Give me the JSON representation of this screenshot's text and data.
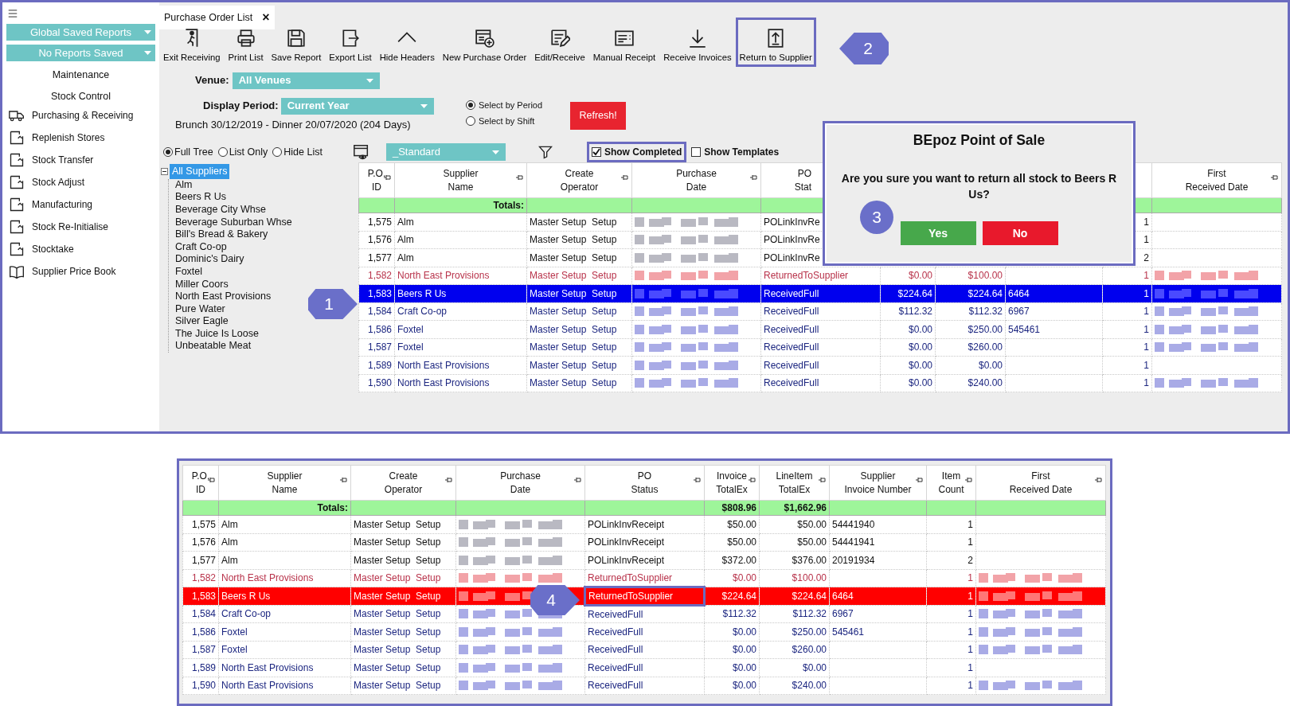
{
  "sidebar": {
    "reports": [
      {
        "label": "Global Saved Reports"
      },
      {
        "label": "No Reports Saved"
      }
    ],
    "sections": [
      {
        "label": "Maintenance"
      },
      {
        "label": "Stock Control"
      }
    ],
    "items": [
      {
        "label": "Purchasing & Receiving",
        "kind": "truck"
      },
      {
        "label": "Replenish Stores",
        "kind": "doc"
      },
      {
        "label": "Stock Transfer",
        "kind": "doc"
      },
      {
        "label": "Stock Adjust",
        "kind": "doc"
      },
      {
        "label": "Manufacturing",
        "kind": "doc"
      },
      {
        "label": "Stock Re-Initialise",
        "kind": "doc"
      },
      {
        "label": "Stocktake",
        "kind": "doc"
      },
      {
        "label": "Supplier Price Book",
        "kind": "book"
      }
    ]
  },
  "tab": {
    "label": "Purchase Order List",
    "close": "×"
  },
  "toolbar": [
    {
      "label": "Exit Receiving",
      "kind": "exit",
      "highlighted": false
    },
    {
      "label": "Print List",
      "kind": "print",
      "highlighted": false
    },
    {
      "label": "Save Report",
      "kind": "save",
      "highlighted": false
    },
    {
      "label": "Export List",
      "kind": "export",
      "highlighted": false
    },
    {
      "label": "Hide Headers",
      "kind": "hide",
      "highlighted": false
    },
    {
      "label": "New Purchase Order",
      "kind": "new",
      "highlighted": false
    },
    {
      "label": "Edit/Receive",
      "kind": "edit",
      "highlighted": false
    },
    {
      "label": "Manual Receipt",
      "kind": "receipt",
      "highlighted": false
    },
    {
      "label": "Receive Invoices",
      "kind": "download",
      "highlighted": false
    },
    {
      "label": "Return to Supplier",
      "kind": "upload",
      "highlighted": true
    }
  ],
  "venue": {
    "label": "Venue:",
    "value": "All Venues"
  },
  "period": {
    "label": "Display Period:",
    "value": "Current Year",
    "range": "Brunch 30/12/2019 - Dinner 20/07/2020 (204 Days)"
  },
  "period_modes": [
    {
      "label": "Select by Period",
      "selected": true
    },
    {
      "label": "Select by Shift",
      "selected": false
    }
  ],
  "refresh": "Refresh!",
  "list_modes": [
    {
      "label": "Full Tree",
      "selected": true
    },
    {
      "label": "List Only",
      "selected": false
    },
    {
      "label": "Hide List",
      "selected": false
    }
  ],
  "layout_select": {
    "value": "_Standard"
  },
  "toggles": [
    {
      "label": "Show Completed",
      "checked": true,
      "highlighted": true
    },
    {
      "label": "Show Templates",
      "checked": false,
      "highlighted": false
    }
  ],
  "tree": {
    "label": "All Suppliers",
    "selected": true,
    "expanded": true,
    "children": [
      {
        "label": "Alm",
        "selected": false
      },
      {
        "label": "Beers R Us",
        "selected": false
      },
      {
        "label": "Beverage City Whse",
        "selected": false
      },
      {
        "label": "Beverage Suburban Whse",
        "selected": false
      },
      {
        "label": "Bill's Bread & Bakery",
        "selected": false
      },
      {
        "label": "Craft Co-op",
        "selected": false
      },
      {
        "label": "Dominic's Dairy",
        "selected": false
      },
      {
        "label": "Foxtel",
        "selected": false
      },
      {
        "label": "Miller Coors",
        "selected": false
      },
      {
        "label": "North East Provisions",
        "selected": false
      },
      {
        "label": "Pure Water",
        "selected": false
      },
      {
        "label": "Silver Eagle",
        "selected": false
      },
      {
        "label": "The Juice Is Loose",
        "selected": false
      },
      {
        "label": "Unbeatable Meat",
        "selected": false
      }
    ]
  },
  "orders_table": {
    "columns": [
      {
        "label": "P.O. ID"
      },
      {
        "label": "Supplier Name"
      },
      {
        "label": "Create Operator"
      },
      {
        "label": "Purchase Date"
      },
      {
        "label": "PO Stat"
      },
      null,
      null,
      null,
      null,
      {
        "label": "First Received Date"
      }
    ],
    "totals_label": "Totals:",
    "rows": [
      {
        "id": "1,575",
        "supplier": "Alm",
        "operator": "Master Setup  Setup",
        "status": "POLinkInvRe",
        "count": "1",
        "kind": "linked",
        "selected": false,
        "received_redacted": false
      },
      {
        "id": "1,576",
        "supplier": "Alm",
        "operator": "Master Setup  Setup",
        "status": "POLinkInvRe",
        "count": "1",
        "kind": "linked",
        "selected": false,
        "received_redacted": false
      },
      {
        "id": "1,577",
        "supplier": "Alm",
        "operator": "Master Setup  Setup",
        "status": "POLinkInvRe",
        "count": "2",
        "kind": "linked",
        "selected": false,
        "received_redacted": false
      },
      {
        "id": "1,582",
        "supplier": "North East Provisions",
        "operator": "Master Setup  Setup",
        "status": "ReturnedToSupplier",
        "invoice": "$0.00",
        "lineitem": "$100.00",
        "count": "1",
        "kind": "returned",
        "selected": false,
        "received_redacted": true
      },
      {
        "id": "1,583",
        "supplier": "Beers R Us",
        "operator": "Master Setup  Setup",
        "status": "ReceivedFull",
        "invoice": "$224.64",
        "lineitem": "$224.64",
        "invoice_no": "6464",
        "count": "1",
        "kind": "received",
        "selected": true,
        "received_redacted": true
      },
      {
        "id": "1,584",
        "supplier": "Craft Co-op",
        "operator": "Master Setup  Setup",
        "status": "ReceivedFull",
        "invoice": "$112.32",
        "lineitem": "$112.32",
        "invoice_no": "6967",
        "count": "1",
        "kind": "received",
        "selected": false,
        "received_redacted": true
      },
      {
        "id": "1,586",
        "supplier": "Foxtel",
        "operator": "Master Setup  Setup",
        "status": "ReceivedFull",
        "invoice": "$0.00",
        "lineitem": "$250.00",
        "invoice_no": "545461",
        "count": "1",
        "kind": "received",
        "selected": false,
        "received_redacted": true
      },
      {
        "id": "1,587",
        "supplier": "Foxtel",
        "operator": "Master Setup  Setup",
        "status": "ReceivedFull",
        "invoice": "$0.00",
        "lineitem": "$260.00",
        "count": "1",
        "kind": "received",
        "selected": false,
        "received_redacted": true
      },
      {
        "id": "1,589",
        "supplier": "North East Provisions",
        "operator": "Master Setup  Setup",
        "status": "ReceivedFull",
        "invoice": "$0.00",
        "lineitem": "$0.00",
        "count": "1",
        "kind": "received",
        "selected": false,
        "received_redacted": false
      },
      {
        "id": "1,590",
        "supplier": "North East Provisions",
        "operator": "Master Setup  Setup",
        "status": "ReceivedFull",
        "invoice": "$0.00",
        "lineitem": "$240.00",
        "count": "1",
        "kind": "received",
        "selected": false,
        "received_redacted": true
      }
    ]
  },
  "dialog": {
    "title": "BEpoz Point of Sale",
    "message": "Are you sure you want to return all stock to Beers R Us?",
    "buttons": [
      {
        "label": "Yes",
        "kind": "confirm"
      },
      {
        "label": "No",
        "kind": "cancel"
      }
    ]
  },
  "callouts": [
    {
      "label": "1"
    },
    {
      "label": "2"
    },
    {
      "label": "3"
    },
    {
      "label": "4"
    }
  ],
  "result_table": {
    "columns": [
      {
        "label": "P.O. ID"
      },
      {
        "label": "Supplier Name"
      },
      {
        "label": "Create Operator"
      },
      {
        "label": "Purchase Date"
      },
      {
        "label": "PO Status"
      },
      {
        "label": "Invoice TotalEx"
      },
      {
        "label": "LineItem TotalEx"
      },
      {
        "label": "Supplier Invoice Number"
      },
      {
        "label": "Item Count"
      },
      {
        "label": "First Received Date"
      }
    ],
    "totals_label": "Totals:",
    "totals": {
      "invoice": "$808.96",
      "lineitem": "$1,662.96"
    },
    "rows": [
      {
        "id": "1,575",
        "supplier": "Alm",
        "operator": "Master Setup  Setup",
        "status": "POLinkInvReceipt",
        "invoice": "$50.00",
        "lineitem": "$50.00",
        "invoice_no": "54441940",
        "count": "1",
        "kind": "linked",
        "selected": false,
        "received_redacted": false,
        "highlighted": false
      },
      {
        "id": "1,576",
        "supplier": "Alm",
        "operator": "Master Setup  Setup",
        "status": "POLinkInvReceipt",
        "invoice": "$50.00",
        "lineitem": "$50.00",
        "invoice_no": "54441941",
        "count": "1",
        "kind": "linked",
        "selected": false,
        "received_redacted": false,
        "highlighted": false
      },
      {
        "id": "1,577",
        "supplier": "Alm",
        "operator": "Master Setup  Setup",
        "status": "POLinkInvReceipt",
        "invoice": "$372.00",
        "lineitem": "$376.00",
        "invoice_no": "20191934",
        "count": "2",
        "kind": "linked",
        "selected": false,
        "received_redacted": false,
        "highlighted": false
      },
      {
        "id": "1,582",
        "supplier": "North East Provisions",
        "operator": "Master Setup  Setup",
        "status": "ReturnedToSupplier",
        "invoice": "$0.00",
        "lineitem": "$100.00",
        "count": "1",
        "kind": "returned",
        "selected": false,
        "received_redacted": true,
        "highlighted": false
      },
      {
        "id": "1,583",
        "supplier": "Beers R Us",
        "operator": "Master Setup  Setup",
        "status": "ReturnedToSupplier",
        "invoice": "$224.64",
        "lineitem": "$224.64",
        "invoice_no": "6464",
        "count": "1",
        "kind": "returned",
        "selected": true,
        "received_redacted": true,
        "highlighted": true
      },
      {
        "id": "1,584",
        "supplier": "Craft Co-op",
        "operator": "Master Setup  Setup",
        "status": "ReceivedFull",
        "invoice": "$112.32",
        "lineitem": "$112.32",
        "invoice_no": "6967",
        "count": "1",
        "kind": "received",
        "selected": false,
        "received_redacted": true,
        "highlighted": false
      },
      {
        "id": "1,586",
        "supplier": "Foxtel",
        "operator": "Master Setup  Setup",
        "status": "ReceivedFull",
        "invoice": "$0.00",
        "lineitem": "$250.00",
        "invoice_no": "545461",
        "count": "1",
        "kind": "received",
        "selected": false,
        "received_redacted": true,
        "highlighted": false
      },
      {
        "id": "1,587",
        "supplier": "Foxtel",
        "operator": "Master Setup  Setup",
        "status": "ReceivedFull",
        "invoice": "$0.00",
        "lineitem": "$260.00",
        "count": "1",
        "kind": "received",
        "selected": false,
        "received_redacted": true,
        "highlighted": false
      },
      {
        "id": "1,589",
        "supplier": "North East Provisions",
        "operator": "Master Setup  Setup",
        "status": "ReceivedFull",
        "invoice": "$0.00",
        "lineitem": "$0.00",
        "count": "1",
        "kind": "received",
        "selected": false,
        "received_redacted": false,
        "highlighted": false
      },
      {
        "id": "1,590",
        "supplier": "North East Provisions",
        "operator": "Master Setup  Setup",
        "status": "ReceivedFull",
        "invoice": "$0.00",
        "lineitem": "$240.00",
        "count": "1",
        "kind": "received",
        "selected": false,
        "received_redacted": true,
        "highlighted": false
      }
    ]
  }
}
